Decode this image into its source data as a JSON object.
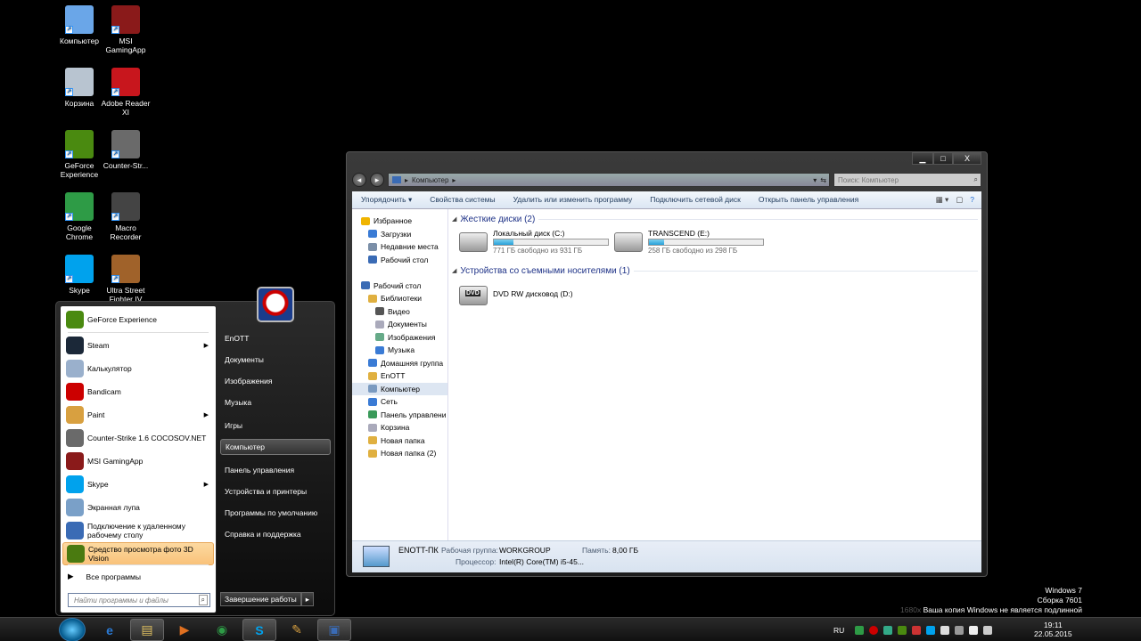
{
  "desktop_icons": [
    {
      "label": "Компьютер",
      "color": "#6aa6e8"
    },
    {
      "label": "MSI GamingApp",
      "color": "#8a1a1a"
    },
    {
      "label": "Корзина",
      "color": "#b8c4d0"
    },
    {
      "label": "Adobe Reader XI",
      "color": "#c8161d"
    },
    {
      "label": "GeForce Experience",
      "color": "#4a8a10"
    },
    {
      "label": "Counter-Str...",
      "color": "#6a6a6a"
    },
    {
      "label": "Google Chrome",
      "color": "#2e9b46"
    },
    {
      "label": "Macro Recorder",
      "color": "#444"
    },
    {
      "label": "Skype",
      "color": "#00a2ed"
    },
    {
      "label": "Ultra Street Fighter IV",
      "color": "#a0622a"
    }
  ],
  "explorer": {
    "window_controls": [
      "▁",
      "□",
      "X"
    ],
    "breadcrumb_root": "Компьютер",
    "search_placeholder": "Поиск: Компьютер",
    "commands": [
      "Упорядочить ▾",
      "Свойства системы",
      "Удалить или изменить программу",
      "Подключить сетевой диск",
      "Открыть панель управления"
    ],
    "tree": [
      {
        "label": "Избранное",
        "indent": 0,
        "color": "#f0b400"
      },
      {
        "label": "Загрузки",
        "indent": 1,
        "color": "#3a7bd5"
      },
      {
        "label": "Недавние места",
        "indent": 1,
        "color": "#7b8fa8"
      },
      {
        "label": "Рабочий стол",
        "indent": 1,
        "color": "#3a6bb5"
      },
      {
        "label": "",
        "indent": 0,
        "color": ""
      },
      {
        "label": "Рабочий стол",
        "indent": 0,
        "color": "#3a6bb5"
      },
      {
        "label": "Библиотеки",
        "indent": 1,
        "color": "#e0b040"
      },
      {
        "label": "Видео",
        "indent": 2,
        "color": "#555"
      },
      {
        "label": "Документы",
        "indent": 2,
        "color": "#aab"
      },
      {
        "label": "Изображения",
        "indent": 2,
        "color": "#6a8"
      },
      {
        "label": "Музыка",
        "indent": 2,
        "color": "#3a7bd5"
      },
      {
        "label": "Домашняя группа",
        "indent": 1,
        "color": "#3a7bd5"
      },
      {
        "label": "EnOTT",
        "indent": 1,
        "color": "#e0b040"
      },
      {
        "label": "Компьютер",
        "indent": 1,
        "color": "#7a9ac0",
        "selected": true
      },
      {
        "label": "Сеть",
        "indent": 1,
        "color": "#3a7bd5"
      },
      {
        "label": "Панель управлени",
        "indent": 1,
        "color": "#3a9a5a"
      },
      {
        "label": "Корзина",
        "indent": 1,
        "color": "#aab"
      },
      {
        "label": "Новая папка",
        "indent": 1,
        "color": "#e0b040"
      },
      {
        "label": "Новая папка (2)",
        "indent": 1,
        "color": "#e0b040"
      }
    ],
    "groups": {
      "hard_drives": "Жесткие диски (2)",
      "removable": "Устройства со съемными носителями (1)"
    },
    "drives": [
      {
        "name": "Локальный диск (C:)",
        "free": "771 ГБ свободно из 931 ГБ",
        "used_fraction": 0.17
      },
      {
        "name": "TRANSCEND (E:)",
        "free": "258 ГБ свободно из 298 ГБ",
        "used_fraction": 0.13
      }
    ],
    "dvd": {
      "name": "DVD RW дисковод (D:)",
      "badge": "DVD"
    },
    "details": {
      "pc_name": "ENOTT-ПК",
      "workgroup_label": "Рабочая группа:",
      "workgroup": "WORKGROUP",
      "memory_label": "Память:",
      "memory": "8,00 ГБ",
      "cpu_label": "Процессор:",
      "cpu": "Intel(R) Core(TM) i5-45..."
    }
  },
  "start_menu": {
    "programs": [
      {
        "label": "GeForce Experience",
        "color": "#4a8a10",
        "submenu": false
      },
      {
        "label": "Steam",
        "color": "#1b2838",
        "submenu": true
      },
      {
        "label": "Калькулятор",
        "color": "#9ab0cc",
        "submenu": false
      },
      {
        "label": "Bandicam",
        "color": "#c00",
        "submenu": false
      },
      {
        "label": "Paint",
        "color": "#d8a040",
        "submenu": true
      },
      {
        "label": "Counter-Strike 1.6 COCOSOV.NET",
        "color": "#6a6a6a",
        "submenu": false
      },
      {
        "label": "MSI GamingApp",
        "color": "#8a1a1a",
        "submenu": false
      },
      {
        "label": "Skype",
        "color": "#00a2ed",
        "submenu": true
      },
      {
        "label": "Экранная лупа",
        "color": "#7aa0c8",
        "submenu": false
      },
      {
        "label": "Подключение к удаленному рабочему столу",
        "color": "#3a6bb5",
        "submenu": false
      },
      {
        "label": "Средство просмотра фото 3D Vision",
        "color": "#4a7a10",
        "submenu": false,
        "highlighted": true
      }
    ],
    "all_programs": "Все программы",
    "search_placeholder": "Найти программы и файлы",
    "right_items": [
      {
        "label": "EnOTT"
      },
      {
        "label": "Документы"
      },
      {
        "label": "Изображения"
      },
      {
        "label": "Музыка"
      },
      {
        "label": "Игры"
      },
      {
        "label": "Компьютер",
        "selected": true
      },
      {
        "label": "Панель управления"
      },
      {
        "label": "Устройства и принтеры"
      },
      {
        "label": "Программы по умолчанию"
      },
      {
        "label": "Справка и поддержка"
      }
    ],
    "shutdown": "Завершение работы",
    "shutdown_arrow": "▸"
  },
  "taskbar": {
    "buttons": [
      {
        "name": "ie",
        "glyph": "e",
        "color": "#2a7ad5"
      },
      {
        "name": "explorer",
        "glyph": "▤",
        "color": "#e0c060",
        "active": true
      },
      {
        "name": "media-player",
        "glyph": "▶",
        "color": "#e07020"
      },
      {
        "name": "chrome",
        "glyph": "◉",
        "color": "#2e9b46"
      },
      {
        "name": "skype",
        "glyph": "S",
        "color": "#00a2ed",
        "active": true
      },
      {
        "name": "paint",
        "glyph": "✎",
        "color": "#d8a040"
      },
      {
        "name": "remote",
        "glyph": "▣",
        "color": "#3a6bb5",
        "active": true
      }
    ],
    "language": "RU",
    "time": "19:11",
    "date": "22.05.2015"
  },
  "watermark": {
    "line1": "Windows 7",
    "line2": "Сборка 7601",
    "line3_dim": "1680х",
    "line3": "Ваша копия Windows не является подлинной"
  }
}
